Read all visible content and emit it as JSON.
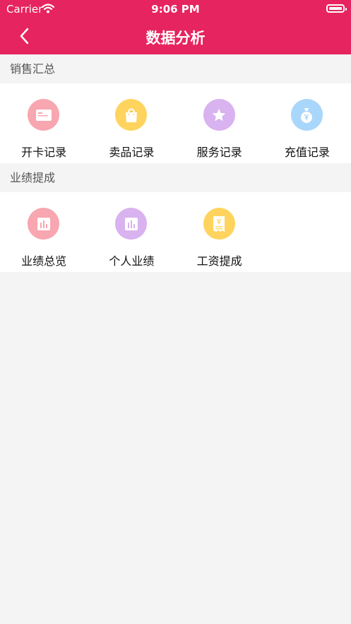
{
  "status": {
    "carrier": "Carrier",
    "time": "9:06 PM"
  },
  "nav": {
    "title": "数据分析"
  },
  "sections": [
    {
      "title": "销售汇总",
      "items": [
        {
          "label": "开卡记录",
          "icon": "card-icon",
          "color": "#f8a6b0"
        },
        {
          "label": "卖品记录",
          "icon": "shopping-bag-icon",
          "color": "#ffd45e"
        },
        {
          "label": "服务记录",
          "icon": "star-icon",
          "color": "#d9b2f0"
        },
        {
          "label": "充值记录",
          "icon": "money-bag-icon",
          "color": "#a9d6fb"
        }
      ]
    },
    {
      "title": "业绩提成",
      "items": [
        {
          "label": "业绩总览",
          "icon": "bar-chart-icon",
          "color": "#f8a6b0"
        },
        {
          "label": "个人业绩",
          "icon": "bar-chart-icon",
          "color": "#d9b2f0"
        },
        {
          "label": "工资提成",
          "icon": "receipt-icon",
          "color": "#ffd45e"
        }
      ]
    }
  ]
}
